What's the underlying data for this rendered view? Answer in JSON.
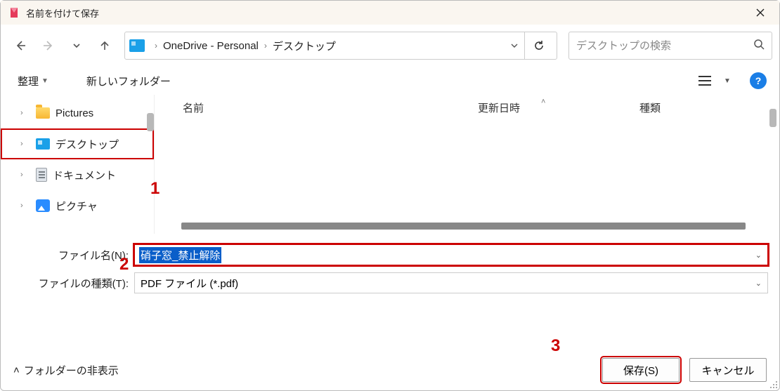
{
  "title": "名前を付けて保存",
  "breadcrumbs": {
    "a": "OneDrive - Personal",
    "b": "デスクトップ"
  },
  "search": {
    "placeholder": "デスクトップの検索"
  },
  "toolbar": {
    "organize": "整理",
    "new_folder": "新しいフォルダー"
  },
  "columns": {
    "name": "名前",
    "date": "更新日時",
    "type": "種類"
  },
  "tree": {
    "pictures": "Pictures",
    "desktop": "デスクトップ",
    "documents": "ドキュメント",
    "pics": "ピクチャ"
  },
  "fields": {
    "filename_label": "ファイル名(N):",
    "filename_value": "硝子窓_禁止解除",
    "filetype_label": "ファイルの種類(T):",
    "filetype_value": "PDF ファイル (*.pdf)"
  },
  "footer": {
    "hide_folders": "フォルダーの非表示",
    "save": "保存(S)",
    "cancel": "キャンセル"
  },
  "annotations": {
    "a1": "1",
    "a2": "2",
    "a3": "3"
  },
  "help": "?"
}
